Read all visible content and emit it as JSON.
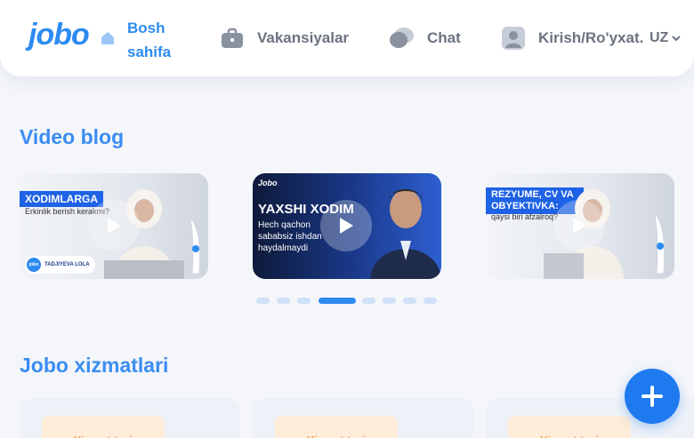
{
  "header": {
    "logo_text": "jobo",
    "nav": {
      "home_label": "Bosh sahifa",
      "vacancies_label": "Vakansiyalar",
      "chat_label": "Chat",
      "login_label": "Kirish/Ro'yxat."
    },
    "language": "UZ"
  },
  "video_blog": {
    "title": "Video blog",
    "videos": [
      {
        "headline": "XODIMLARGA",
        "subtitle": "Erkinlik berish kerakmi?",
        "name_tag": "TADJIYEVA LOLA"
      },
      {
        "logo": "Jobo",
        "headline": "YAXSHI XODIM",
        "subtitle": "Hech qachon sababsiz ishdan haydalmaydi"
      },
      {
        "headline": "REZYUME, CV VA OBYEKTIVKA:",
        "subtitle": "qaysi biri afzalroq?"
      }
    ],
    "carousel": {
      "total": 8,
      "active_index": 3
    }
  },
  "services": {
    "title": "Jobo xizmatlari",
    "cards": [
      {
        "tag": "Xizmat turi"
      },
      {
        "tag": "Xizmat turi"
      },
      {
        "tag": "Xizmat turi"
      }
    ]
  },
  "colors": {
    "brand_blue": "#2d8bf0",
    "fab_blue": "#1f7af0",
    "nav_gray": "#6b7380",
    "tag_orange_text": "#f5a25d",
    "tag_orange_bg": "#ffecd9"
  }
}
